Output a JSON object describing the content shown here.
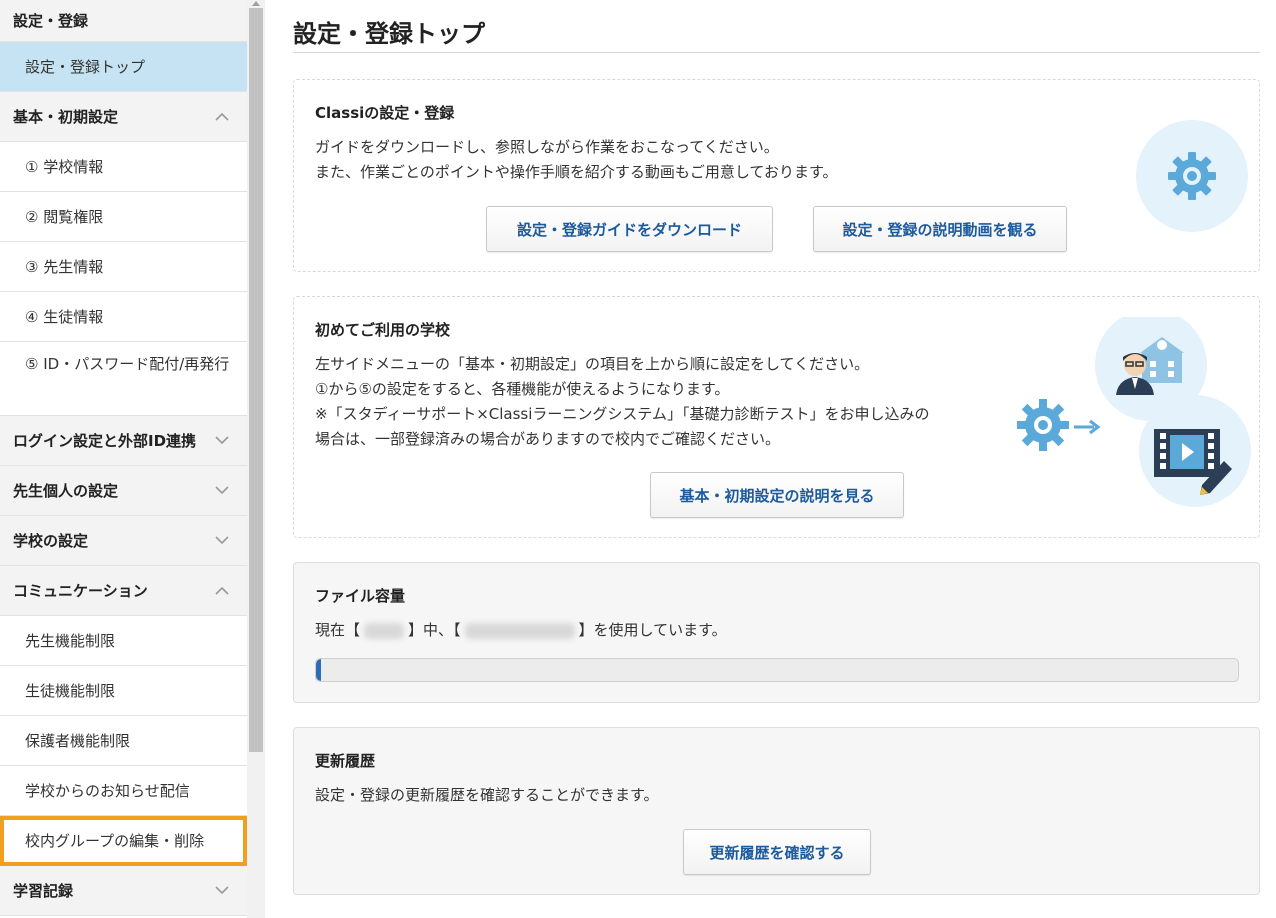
{
  "sidebar": {
    "top_section": "設定・登録",
    "top_item": "設定・登録トップ",
    "basic": {
      "label": "基本・初期設定",
      "items": [
        "① 学校情報",
        "② 閲覧権限",
        "③ 先生情報",
        "④ 生徒情報",
        "⑤ ID・パスワード配付/再発行"
      ]
    },
    "login": "ログイン設定と外部ID連携",
    "teacher_personal": "先生個人の設定",
    "school": "学校の設定",
    "communication": {
      "label": "コミュニケーション",
      "items": [
        "先生機能制限",
        "生徒機能制限",
        "保護者機能制限",
        "学校からのお知らせ配信",
        "校内グループの編集・削除"
      ]
    },
    "learning": "学習記録"
  },
  "main": {
    "title": "設定・登録トップ",
    "classi_card": {
      "title": "Classiの設定・登録",
      "line1": "ガイドをダウンロードし、参照しながら作業をおこなってください。",
      "line2": "また、作業ごとのポイントや操作手順を紹介する動画もご用意しております。",
      "btn_download": "設定・登録ガイドをダウンロード",
      "btn_video": "設定・登録の説明動画を観る"
    },
    "first_card": {
      "title": "初めてご利用の学校",
      "line1": "左サイドメニューの「基本・初期設定」の項目を上から順に設定をしてください。",
      "line2": "①から⑤の設定をすると、各種機能が使えるようになります。",
      "line3": "※「スタディーサポート×Classiラーニングシステム」「基礎力診断テスト」をお申し込みの",
      "line4": "場合は、一部登録済みの場合がありますので校内でご確認ください。",
      "btn": "基本・初期設定の説明を見る"
    },
    "file_card": {
      "title": "ファイル容量",
      "prefix": "現在【",
      "mid": "】中、【",
      "suffix": "】を使用しています。",
      "usage_percent": 0.5
    },
    "history_card": {
      "title": "更新履歴",
      "text": "設定・登録の更新履歴を確認することができます。",
      "btn": "更新履歴を確認する"
    }
  },
  "colors": {
    "accent_blue": "#1d5a9c",
    "active_item": "#c5e3f2",
    "highlight": "#f0a020",
    "icon_bg": "#e3f2fb",
    "icon_blue": "#5aa9d8"
  }
}
